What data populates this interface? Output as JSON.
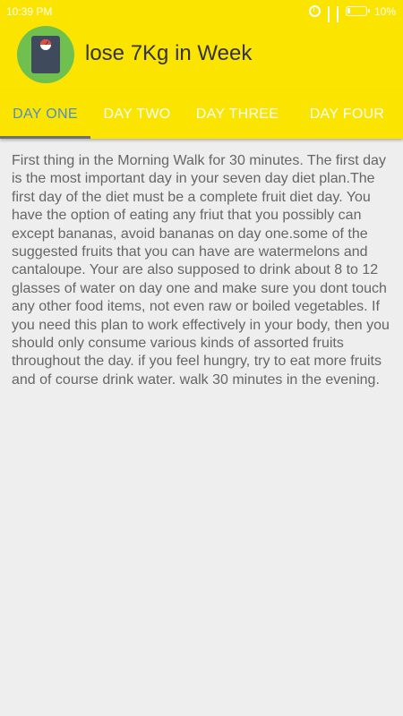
{
  "status_bar": {
    "time": "10:39 PM",
    "battery": "10%",
    "icons": [
      "alarm-icon",
      "signal-icon",
      "signal-icon",
      "battery-icon"
    ]
  },
  "app_bar": {
    "title": "lose 7Kg in Week",
    "logo_icon": "scale-icon"
  },
  "tabs": [
    {
      "label": "DAY ONE",
      "active": true
    },
    {
      "label": "DAY TWO",
      "active": false
    },
    {
      "label": "DAY THREE",
      "active": false
    },
    {
      "label": "DAY FOUR",
      "active": false
    }
  ],
  "content": {
    "text": "First thing in the Morning Walk for 30  minutes. The first day is the most important day in your seven day diet plan.The first day of the diet must be a complete fruit diet day. You have the option of eating any friut that you possibly can except bananas, avoid bananas on day one.some of the suggested fruits that you can have are watermelons and cantaloupe. Your are also supposed to drink about 8 to 12 glasses of water on day one and make sure you dont touch any other food items, not even raw or boiled vegetables. If you need this plan to work effectively in your body, then you should only consume various kinds of assorted fruits throughout the day. if you feel hungry, try to eat more fruits and of course drink water. walk 30 minutes in the evening."
  },
  "colors": {
    "accent": "#fbe400",
    "active_tab": "#4a8ed0",
    "logo_bg": "#6fc04f",
    "body_bg": "#eeeeee"
  }
}
